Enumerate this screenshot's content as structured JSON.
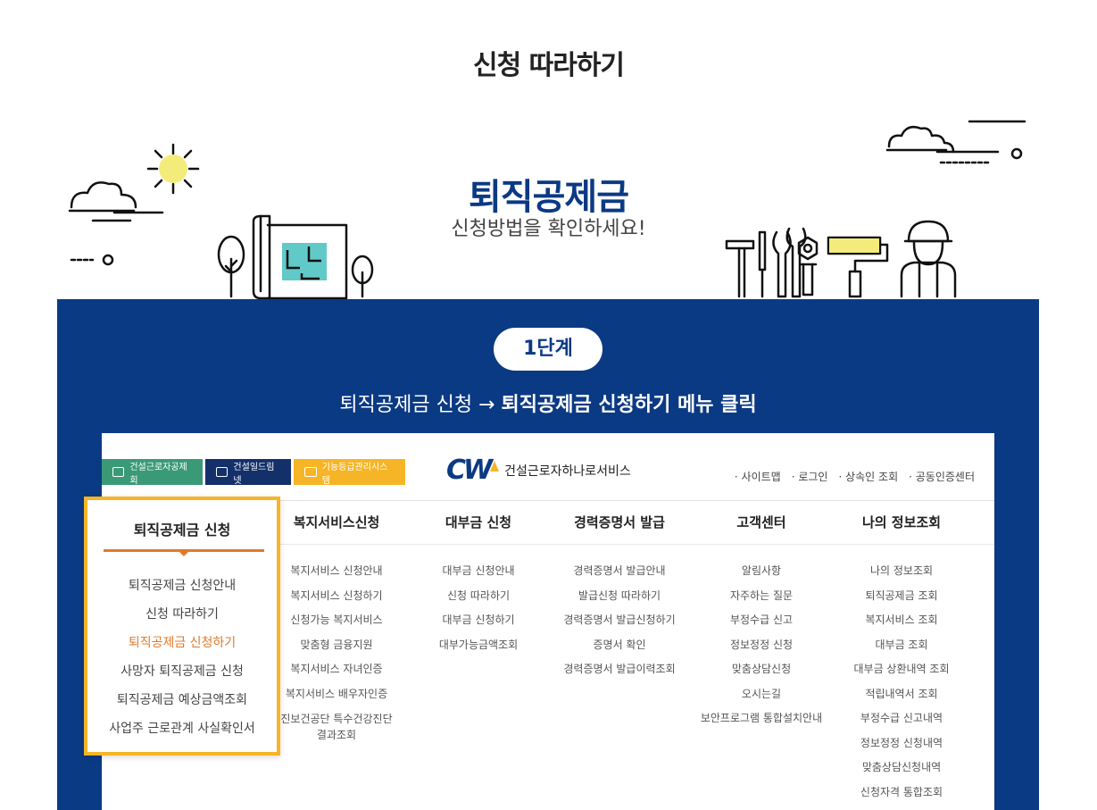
{
  "page_title": "신청 따라하기",
  "hero": {
    "title": "퇴직공제금",
    "subtitle": "신청방법을 확인하세요!"
  },
  "step": {
    "badge": "1단계",
    "desc_prefix": "퇴직공제금 신청 → ",
    "desc_bold": "퇴직공제금 신청하기 메뉴 클릭"
  },
  "site": {
    "top_tabs": [
      "건설근로자공제회",
      "건설일드림넷",
      "기능등급관리시스템"
    ],
    "logo_mark": "CW",
    "logo_text": "건설근로자하나로서비스",
    "util_links": [
      "· 사이트맵",
      "· 로그인",
      "· 상속인 조회",
      "· 공동인증센터"
    ],
    "menus": [
      {
        "head": "퇴직공제금 신청",
        "items": [
          "퇴직공제금 신청안내",
          "신청 따라하기",
          "퇴직공제금 신청하기",
          "사망자 퇴직공제금 신청",
          "퇴직공제금 예상금액조회",
          "사업주 근로관계 사실확인서"
        ],
        "active_index": 2
      },
      {
        "head": "복지서비스신청",
        "items": [
          "복지서비스 신청안내",
          "복지서비스 신청하기",
          "신청가능 복지서비스",
          "맞춤형 금융지원",
          "복지서비스 자녀인증",
          "복지서비스 배우자인증",
          "진보건공단 특수건강진단",
          "결과조회"
        ]
      },
      {
        "head": "대부금 신청",
        "items": [
          "대부금 신청안내",
          "신청 따라하기",
          "대부금 신청하기",
          "대부가능금액조회"
        ]
      },
      {
        "head": "경력증명서 발급",
        "items": [
          "경력증명서 발급안내",
          "발급신청 따라하기",
          "경력증명서 발급신청하기",
          "증명서 확인",
          "경력증명서 발급이력조회"
        ]
      },
      {
        "head": "고객센터",
        "items": [
          "알림사항",
          "자주하는 질문",
          "부정수급 신고",
          "정보정정 신청",
          "맞춤상담신청",
          "오시는길",
          "보안프로그램 통합설치안내"
        ]
      },
      {
        "head": "나의 정보조회",
        "items": [
          "나의 정보조회",
          "퇴직공제금 조회",
          "복지서비스 조회",
          "대부금 조회",
          "대부금 상환내역 조회",
          "적립내역서 조회",
          "부정수급 신고내역",
          "정보정정 신청내역",
          "맞춤상담신청내역",
          "신청자격 통합조회"
        ]
      }
    ]
  },
  "colors": {
    "navy": "#0b3a84",
    "accent": "#f6b526",
    "active": "#e07a2a",
    "green": "#3a9a78"
  }
}
